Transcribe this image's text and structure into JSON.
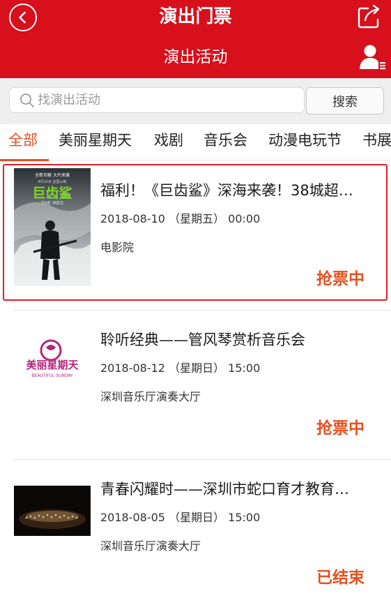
{
  "header": {
    "app_title": "演出门票",
    "sub_title": "演出活动",
    "back_icon": "back-chevron-icon",
    "share_icon": "share-icon",
    "user_icon": "user-list-icon"
  },
  "search": {
    "placeholder": "找演出活动",
    "button_label": "搜索"
  },
  "tabs": [
    {
      "label": "全部",
      "active": true
    },
    {
      "label": "美丽星期天",
      "active": false
    },
    {
      "label": "戏剧",
      "active": false
    },
    {
      "label": "音乐会",
      "active": false
    },
    {
      "label": "动漫电玩节",
      "active": false
    },
    {
      "label": "书展",
      "active": false
    }
  ],
  "events": [
    {
      "title": "福利！《巨齿鲨》深海来袭！38城超…",
      "date": "2018-08-10 （星期五） 00:00",
      "venue": "电影院",
      "status": "抢票中",
      "poster": {
        "top_text": "全新巨献  大片来袭",
        "sub_text": "8月10日 全国公映",
        "logo": "巨齿鲨",
        "logo_en": "THE MEG"
      }
    },
    {
      "title": "聆听经典——管风琴赏析音乐会",
      "date": "2018-08-12 （星期日） 15:00",
      "venue": "深圳音乐厅演奏大厅",
      "status": "抢票中",
      "poster": {
        "logo": "美丽星期天",
        "logo_en": "BEAUTIFUL SUNDAY"
      }
    },
    {
      "title": "青春闪耀时——深圳市蛇口育才教育…",
      "date": "2018-08-05 （星期日） 15:00",
      "venue": "深圳音乐厅演奏大厅",
      "status": "已结束"
    }
  ],
  "colors": {
    "header_red": "#d7101c",
    "accent_orange": "#e5501f",
    "selected_border": "#e21c24"
  }
}
